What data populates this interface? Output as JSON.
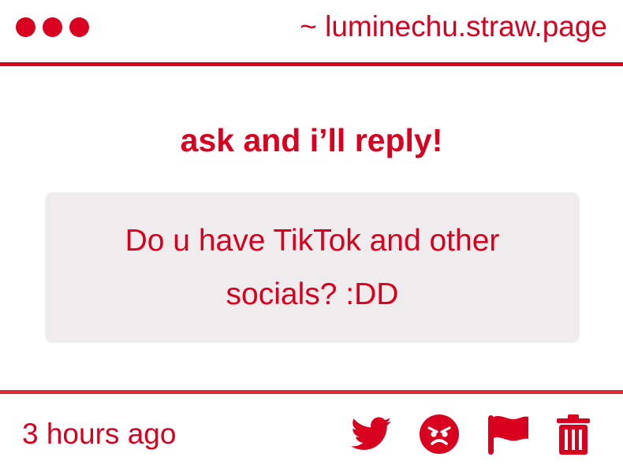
{
  "header": {
    "site_url": "~ luminechu.straw.page"
  },
  "main": {
    "title": "ask and i’ll reply!",
    "question": "Do u have TikTok and other socials? :DD"
  },
  "footer": {
    "timestamp": "3 hours ago",
    "actions": [
      "twitter-share",
      "angry-react",
      "report-flag",
      "delete"
    ]
  },
  "colors": {
    "accent": "#d8001e",
    "question_bg": "#eeeced"
  }
}
